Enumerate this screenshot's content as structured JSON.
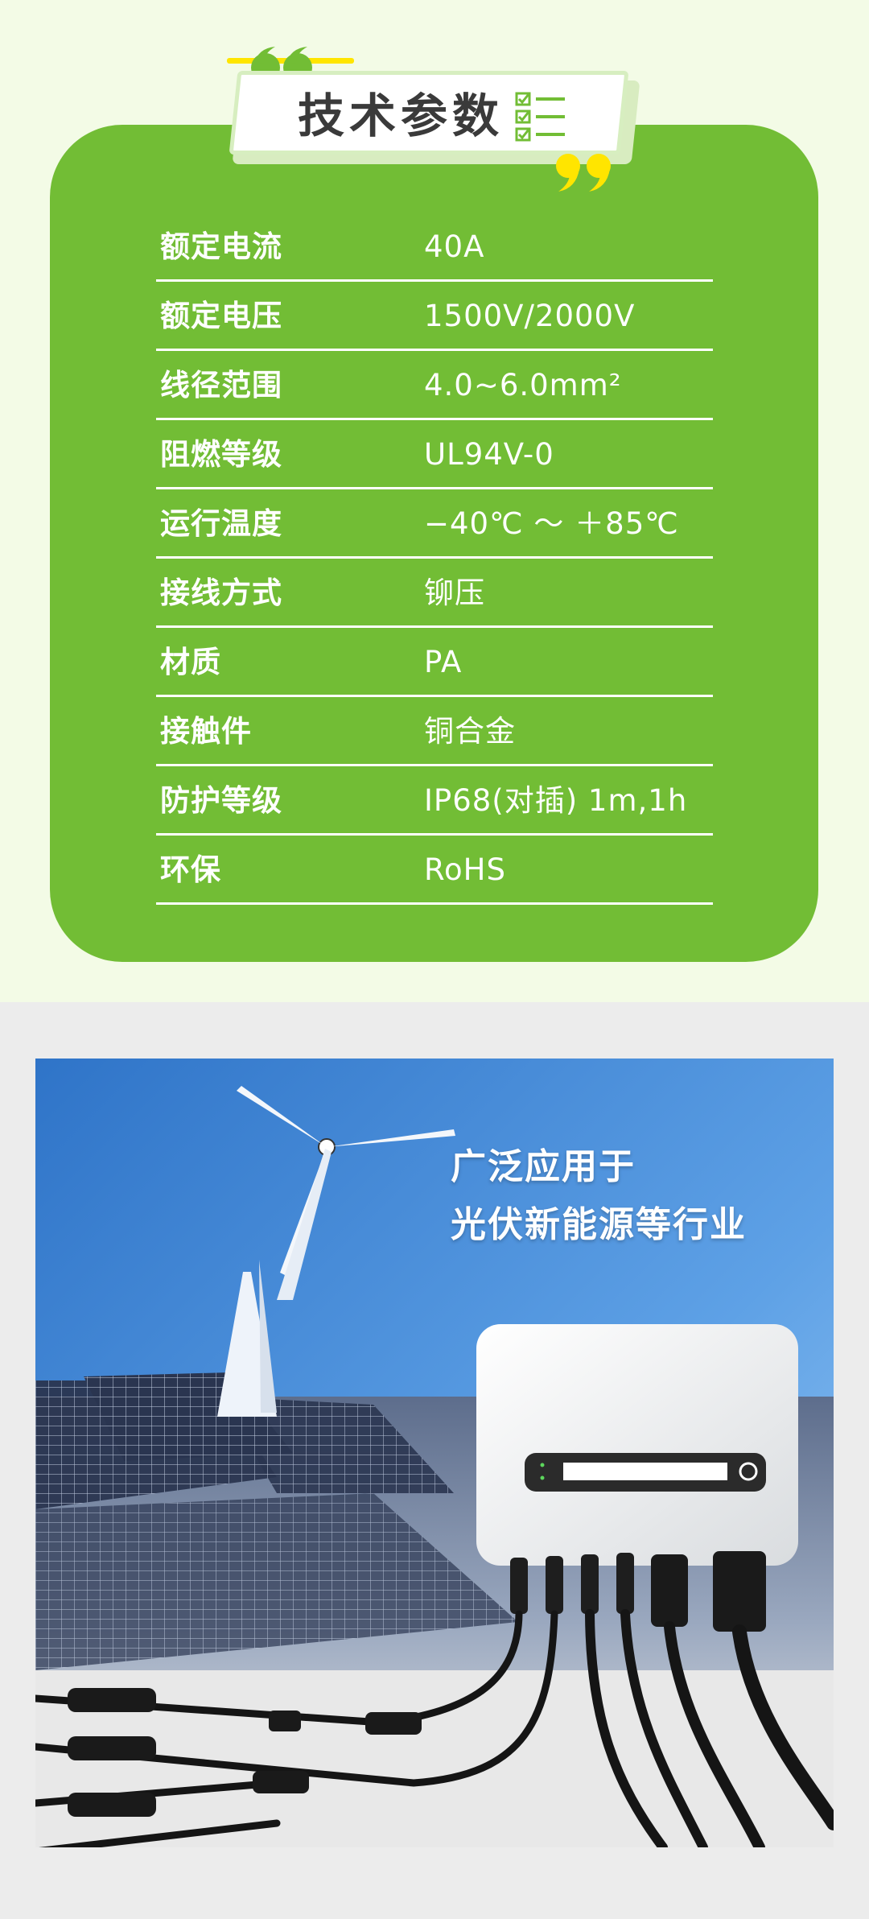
{
  "title": "技术参数",
  "specs": [
    {
      "label": "额定电流",
      "value": "40A"
    },
    {
      "label": "额定电压",
      "value": "1500V/2000V"
    },
    {
      "label": "线径范围",
      "value": "4.0~6.0mm²"
    },
    {
      "label": "阻燃等级",
      "value": "UL94V-0"
    },
    {
      "label": "运行温度",
      "value": "−40℃ ～ ＋85℃"
    },
    {
      "label": "接线方式",
      "value": "铆压"
    },
    {
      "label": "材质",
      "value": "PA"
    },
    {
      "label": "接触件",
      "value": "铜合金"
    },
    {
      "label": "防护等级",
      "value": "IP68(对插) 1m,1h"
    },
    {
      "label": "环保",
      "value": "RoHS"
    }
  ],
  "tagline": {
    "line1": "广泛应用于",
    "line2": "光伏新能源等行业"
  },
  "colors": {
    "card_green": "#72bd35",
    "quote_green": "#72bd35",
    "quote_yellow": "#ffe500",
    "background": "#f3fbe6"
  },
  "icons": [
    "quote-open-icon",
    "quote-close-icon",
    "checklist-icon"
  ]
}
